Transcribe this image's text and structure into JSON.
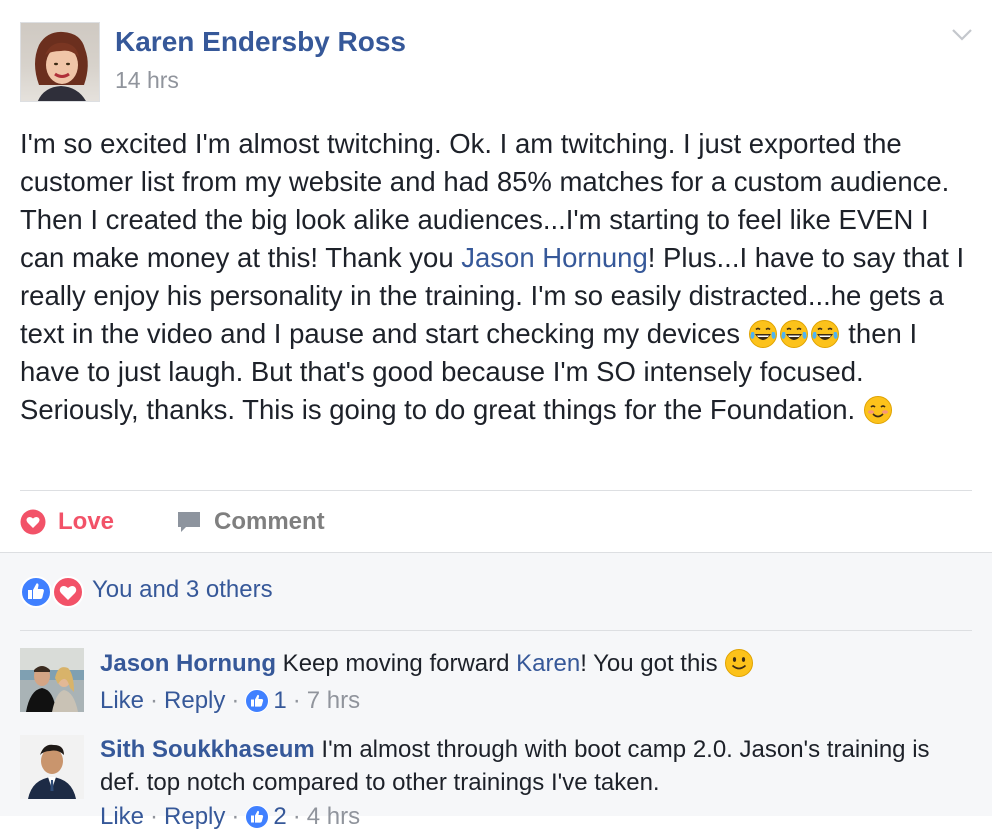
{
  "post": {
    "author": "Karen Endersby Ross",
    "time": "14 hrs",
    "text": {
      "t1": "I'm so excited I'm almost twitching. Ok. I am twitching. I just exported the customer list from my website and had 85% matches for a custom audience. Then I created the big look alike audiences...I'm starting to feel like EVEN I can make money at this! Thank you ",
      "mention": "Jason Hornung",
      "t2": "! Plus...I have to say that I really enjoy his personality in the training. I'm so easily distracted...he gets a text in the video and I pause and start checking my devices ",
      "t3": " then I have to just laugh. But that's good because I'm SO intensely focused. Seriously, thanks. This is going to do great things for the Foundation. "
    },
    "emojis": [
      "tears-of-joy-emoji",
      "tears-of-joy-emoji",
      "tears-of-joy-emoji",
      "smiling-blush-emoji"
    ]
  },
  "actions": {
    "love": "Love",
    "comment": "Comment"
  },
  "reactions": {
    "summary": "You and 3 others",
    "icons": [
      "like-icon",
      "love-icon"
    ]
  },
  "comments": [
    {
      "author": "Jason Hornung",
      "text_before": " Keep moving forward ",
      "mention": "Karen",
      "text_after": "! You got this ",
      "emoji": "slight-smile-emoji",
      "like": "Like",
      "reply": "Reply",
      "likes": "1",
      "time": "7 hrs"
    },
    {
      "author": "Sith Soukkhaseum",
      "text": " I'm almost through with boot camp 2.0. Jason's training is def. top notch compared to other trainings I've taken.",
      "like": "Like",
      "reply": "Reply",
      "likes": "2",
      "time": "4 hrs"
    }
  ],
  "colors": {
    "link": "#365899",
    "love": "#f25268",
    "meta": "#90949c",
    "text": "#1d2129",
    "like_blue": "#4080ff"
  }
}
